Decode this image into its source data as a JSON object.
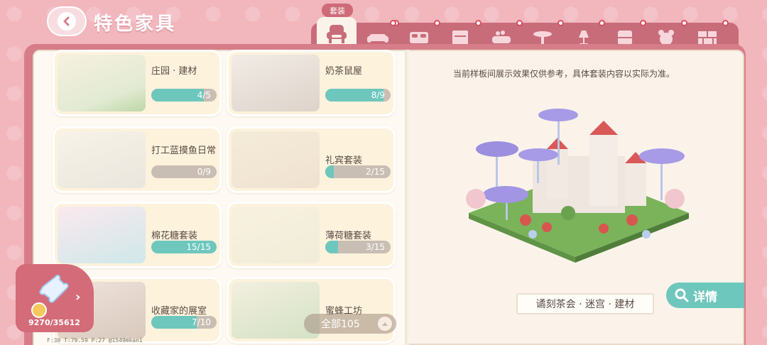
{
  "header": {
    "title": "特色家具",
    "tab_tip": "套装"
  },
  "tabs": [
    {
      "icon": "furniture-set-icon",
      "active": true
    },
    {
      "icon": "sofa-icon"
    },
    {
      "icon": "bed-icon"
    },
    {
      "icon": "cabinet-icon"
    },
    {
      "icon": "bathtub-icon"
    },
    {
      "icon": "table-icon"
    },
    {
      "icon": "lamp-icon"
    },
    {
      "icon": "storage-icon"
    },
    {
      "icon": "plush-toy-icon"
    },
    {
      "icon": "wall-icon"
    }
  ],
  "sets": [
    {
      "name": "庄园 · 建材",
      "count": "4/5",
      "progress": 0.8
    },
    {
      "name": "奶茶鼠屋",
      "count": "8/9",
      "progress": 0.889
    },
    {
      "name": "打工蓝摸鱼日常",
      "count": "0/9",
      "progress": 0.0
    },
    {
      "name": "礼宾套装",
      "count": "2/15",
      "progress": 0.133
    },
    {
      "name": "棉花糖套装",
      "count": "15/15",
      "progress": 1.0
    },
    {
      "name": "薄荷糖套装",
      "count": "3/15",
      "progress": 0.2
    },
    {
      "name": "收藏家的展室",
      "count": "7/10",
      "progress": 0.7
    },
    {
      "name": "蜜蜂工坊",
      "count": "",
      "progress": 0.0
    }
  ],
  "preview": {
    "notice": "当前样板间展示效果仅供参考，具体套装内容以实际为准。",
    "set_name": "谲刻茶会 · 迷宫 · 建材",
    "detail_label": "详情"
  },
  "badge": {
    "points": "9270/35612"
  },
  "all_button": "全部105",
  "debug_text": "F:30  T:79.59  P:27  @1549mkan1",
  "colors": {
    "accent_teal": "#6ec7bd",
    "brand_pink": "#d46b78",
    "page_cream": "#fbf3ea"
  }
}
